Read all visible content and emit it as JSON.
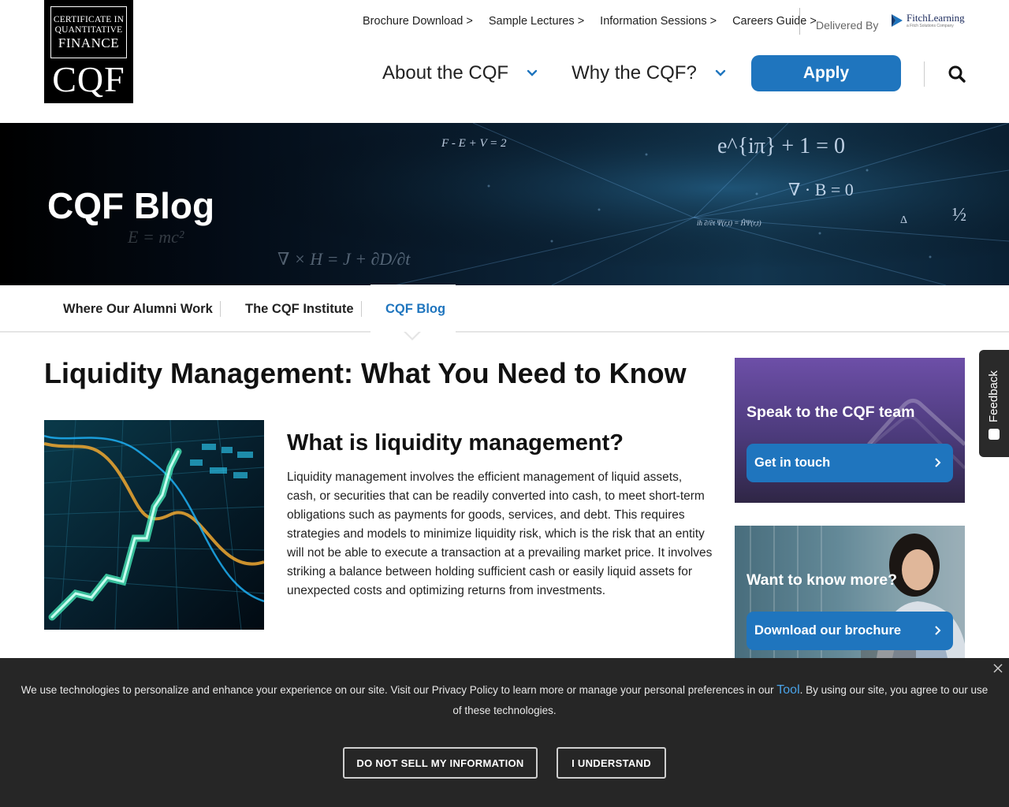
{
  "logo": {
    "line1": "CERTIFICATE IN",
    "line2": "QUANTITATIVE",
    "line3": "FINANCE",
    "mark": "CQF"
  },
  "top_links": [
    {
      "label": "Brochure Download >"
    },
    {
      "label": "Sample Lectures >"
    },
    {
      "label": "Information Sessions >"
    },
    {
      "label": "Careers Guide >"
    }
  ],
  "delivered_by": "Delivered By",
  "partner": {
    "name": "FitchLearning",
    "tagline": "a Fitch Solutions Company"
  },
  "main_nav": [
    {
      "label": "About the CQF"
    },
    {
      "label": "Why the CQF?"
    }
  ],
  "apply_label": "Apply",
  "hero": {
    "title": "CQF Blog",
    "equations": [
      "F - E + V = 2",
      "e^{iπ} + 1 = 0",
      "∇ · B = 0",
      "E = mc²",
      "∇ × H = J + ∂D/∂t",
      "½",
      "iħ ∂/∂t Ψ(r,t) = ĤΨ(r,t)",
      "Δ"
    ]
  },
  "subnav": [
    {
      "label": "Where Our Alumni Work"
    },
    {
      "label": "The CQF Institute"
    },
    {
      "label": "CQF Blog"
    }
  ],
  "article": {
    "title": "Liquidity Management: What You Need to Know",
    "section_title": "What is liquidity management?",
    "section_body": "Liquidity management involves the efficient management of liquid assets, cash, or securities that can be readily converted into cash, to meet short-term obligations such as payments for goods, services, and debt. This requires strategies and models to minimize liquidity risk, which is the risk that an entity will not be able to execute a transaction at a prevailing market price. It involves striking a balance between holding sufficient cash or easily liquid assets for unexpected costs and optimizing returns from investments."
  },
  "sidebar": {
    "card1": {
      "title": "Speak to the CQF team",
      "button": "Get in touch"
    },
    "card2": {
      "title": "Want to know more?",
      "button": "Download our brochure"
    }
  },
  "feedback_label": "Feedback",
  "cookie": {
    "text_before": "We use technologies to personalize and enhance your experience on our site. Visit our Privacy Policy to learn more or manage your personal preferences in our ",
    "tool_link": "Tool",
    "text_after": ". By using our site, you agree to our use of these technologies.",
    "btn_decline": "DO NOT SELL MY INFORMATION",
    "btn_accept": "I UNDERSTAND"
  },
  "colors": {
    "accent": "#1f75be",
    "banner": "#262626",
    "card_purple": "#5a4390"
  }
}
